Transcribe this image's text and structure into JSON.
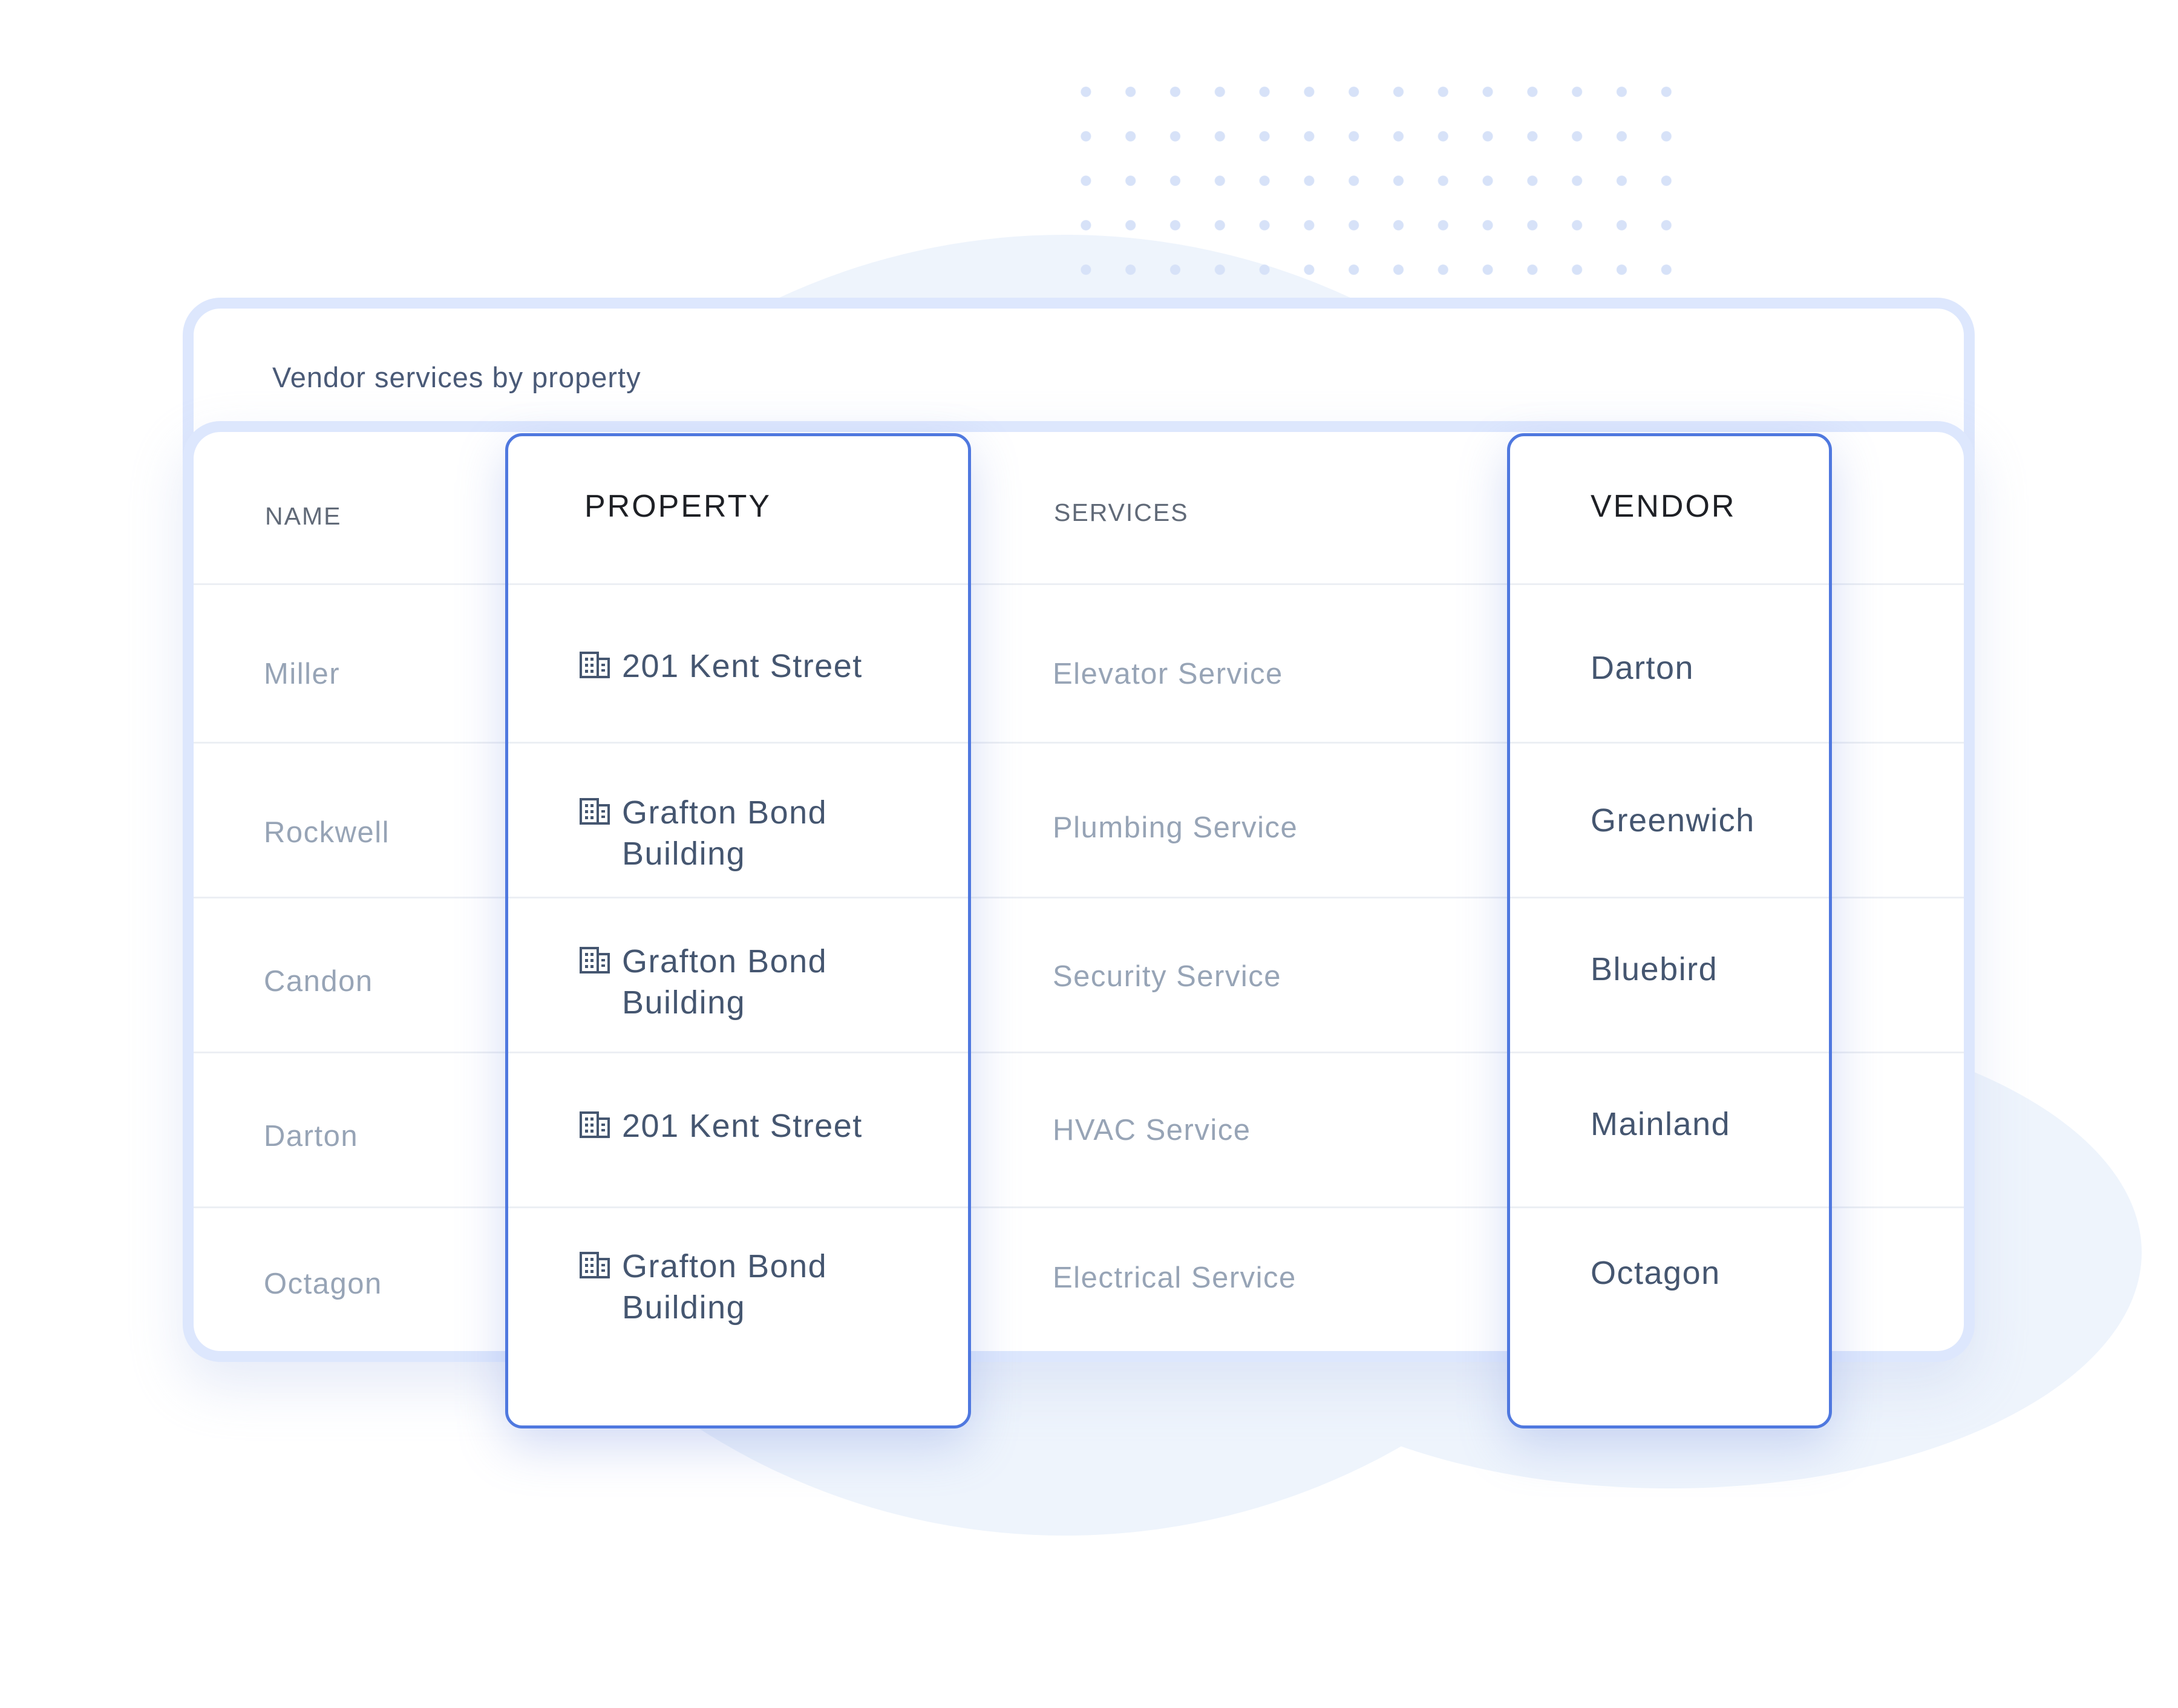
{
  "header": {
    "title": "Vendor services by property"
  },
  "columns": {
    "name": "NAME",
    "property": "PROPERTY",
    "services": "SERVICES",
    "vendor": "VENDOR"
  },
  "rows": [
    {
      "name": "Miller",
      "property": "201 Kent Street",
      "service": "Elevator Service",
      "vendor": "Darton"
    },
    {
      "name": "Rockwell",
      "property": "Grafton Bond Building",
      "service": "Plumbing Service",
      "vendor": "Greenwich"
    },
    {
      "name": "Candon",
      "property": "Grafton Bond Building",
      "service": "Security Service",
      "vendor": "Bluebird"
    },
    {
      "name": "Darton",
      "property": "201 Kent Street",
      "service": "HVAC Service",
      "vendor": "Mainland"
    },
    {
      "name": "Octagon",
      "property": "Grafton Bond Building",
      "service": "Electrical Service",
      "vendor": "Octagon"
    }
  ],
  "icons": {
    "property": "building-icon"
  },
  "colors": {
    "accent": "#4f78df",
    "card_border": "#dde7fd",
    "text_strong": "#455670",
    "text_muted": "#97a4b6"
  }
}
